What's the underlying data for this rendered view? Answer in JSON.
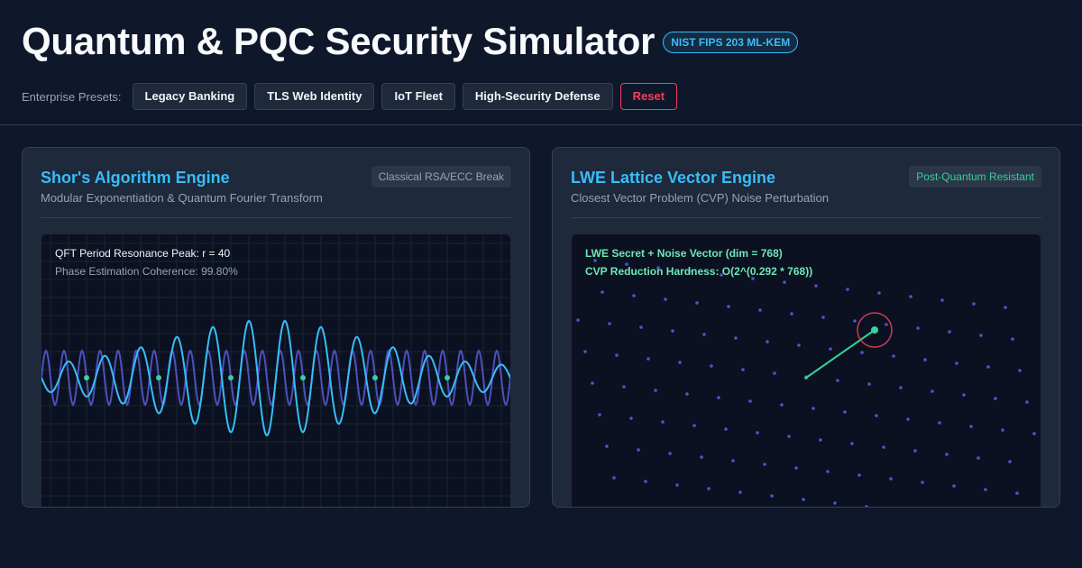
{
  "header": {
    "title": "Quantum & PQC Security Simulator",
    "badge": "NIST FIPS 203 ML-KEM",
    "presets_label": "Enterprise Presets:",
    "presets": [
      "Legacy Banking",
      "TLS Web Identity",
      "IoT Fleet",
      "High-Security Defense"
    ],
    "reset_label": "Reset"
  },
  "shor": {
    "title": "Shor's Algorithm Engine",
    "subtitle": "Modular Exponentiation & Quantum Fourier Transform",
    "tag": "Classical RSA/ECC Break",
    "peak_text": "QFT Period Resonance Peak: r = 40",
    "coherence_text": "Phase Estimation Coherence: 99.80%"
  },
  "lwe": {
    "title": "LWE Lattice Vector Engine",
    "subtitle": "Closest Vector Problem (CVP) Noise Perturbation",
    "tag": "Post-Quantum Resistant",
    "secret_text": "LWE Secret + Noise Vector (dim = 768)",
    "hardness_text": "CVP Reduction Hardness: O(2^(0.292 * 768))"
  },
  "colors": {
    "accent": "#38bdf8",
    "quantum_purple": "#6366f1",
    "success_green": "#34d399",
    "danger_red": "#f43f5e",
    "background": "#0f172a",
    "panel": "#1e293b"
  }
}
